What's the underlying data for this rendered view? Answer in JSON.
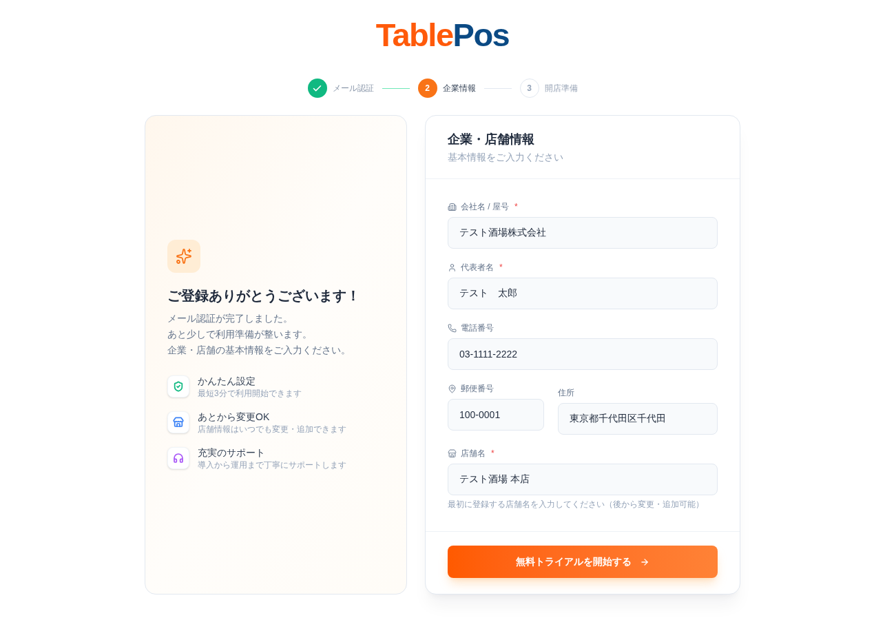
{
  "logo": {
    "parts": [
      {
        "text": "Table",
        "color": "#ff5a0a"
      },
      {
        "text": "Pos",
        "color": "#0b4a84"
      }
    ]
  },
  "steps": [
    {
      "label": "メール認証",
      "kind": "done"
    },
    {
      "number": "2",
      "label": "企業情報",
      "kind": "current"
    },
    {
      "number": "3",
      "label": "開店準備",
      "kind": "upcoming"
    }
  ],
  "welcome": {
    "title": "ご登録ありがとうございます！",
    "message_lines": [
      "メール認証が完了しました。",
      "あと少しで利用準備が整います。",
      "企業・店舗の基本情報をご入力ください。"
    ],
    "features": [
      {
        "title": "かんたん設定",
        "description": "最短3分で利用開始できます",
        "color": "#10b981"
      },
      {
        "title": "あとから変更OK",
        "description": "店舗情報はいつでも変更・追加できます",
        "color": "#3b82f6"
      },
      {
        "title": "充実のサポート",
        "description": "導入から運用まで丁寧にサポートします",
        "color": "#a855f7"
      }
    ]
  },
  "form": {
    "title": "企業・店舗情報",
    "subtitle": "基本情報をご入力ください",
    "required_mark": "*",
    "rows": [
      {
        "fields": [
          {
            "label": "会社名 / 屋号",
            "required": true,
            "value": "テスト酒場株式会社"
          }
        ]
      },
      {
        "fields": [
          {
            "label": "代表者名",
            "required": true,
            "value": "テスト　太郎"
          }
        ]
      },
      {
        "fields": [
          {
            "label": "電話番号",
            "required": false,
            "value": "03-1111-2222"
          }
        ]
      },
      {
        "fields": [
          {
            "label": "郵便番号",
            "required": false,
            "value": "100-0001"
          },
          {
            "label": "住所",
            "required": false,
            "value": "東京都千代田区千代田"
          }
        ]
      },
      {
        "fields": [
          {
            "label": "店舗名",
            "required": true,
            "value": "テスト酒場 本店",
            "hint": "最初に登録する店舗名を入力してください（後から変更・追加可能）"
          }
        ]
      }
    ],
    "submit_button": {
      "label": "無料トライアルを開始する"
    }
  }
}
